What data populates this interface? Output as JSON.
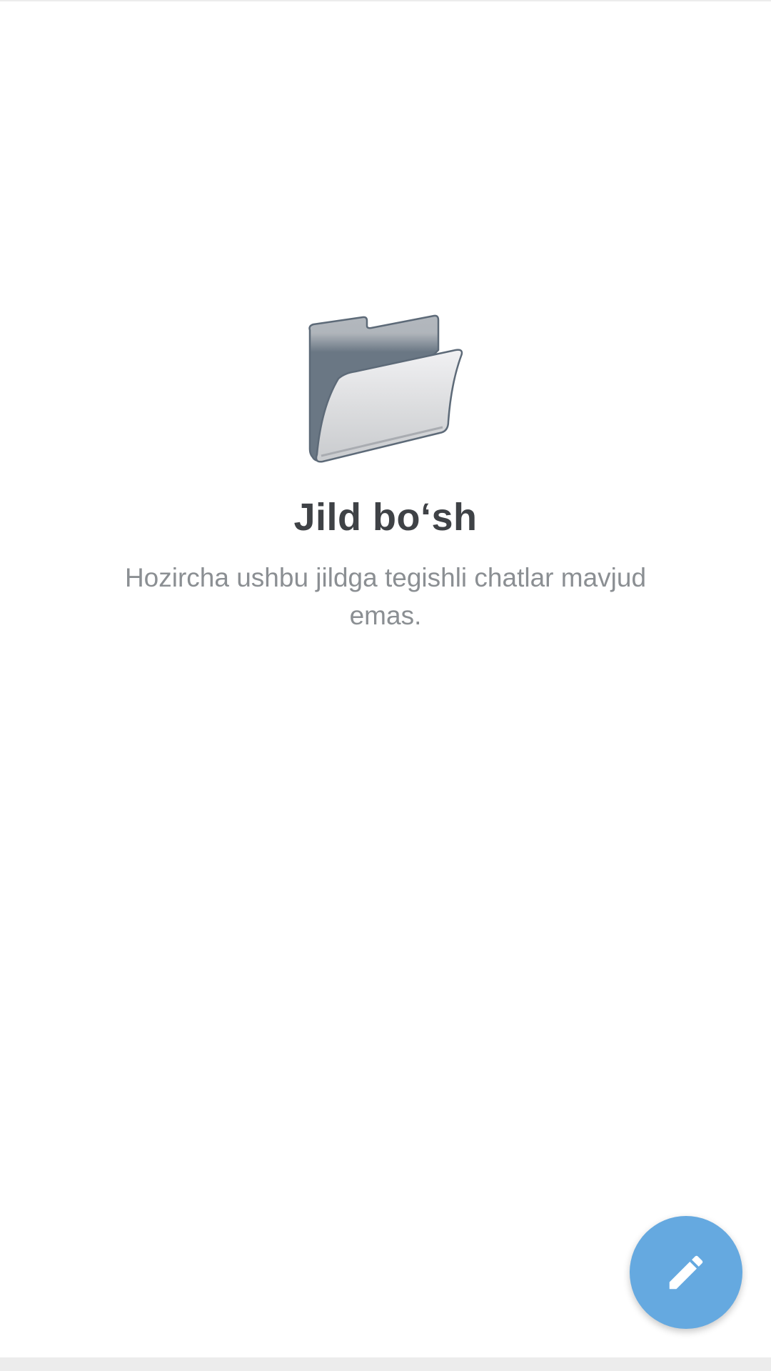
{
  "empty_state": {
    "icon": "folder-icon",
    "title": "Jild bo‘sh",
    "subtitle": "Hozircha ushbu jildga tegishli chatlar mavjud emas."
  },
  "fab": {
    "icon": "pencil-icon",
    "color": "#65a9e0"
  }
}
